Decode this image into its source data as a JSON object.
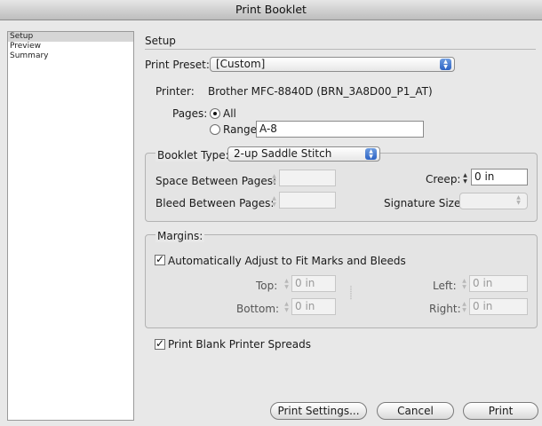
{
  "window": {
    "title": "Print Booklet"
  },
  "sidebar": {
    "items": [
      {
        "label": "Setup",
        "selected": true
      },
      {
        "label": "Preview",
        "selected": false
      },
      {
        "label": "Summary",
        "selected": false
      }
    ]
  },
  "setup": {
    "section_title": "Setup",
    "print_preset_label": "Print Preset:",
    "print_preset_value": "[Custom]",
    "printer_label": "Printer:",
    "printer_value": "Brother MFC-8840D (BRN_3A8D00_P1_AT)",
    "pages_label": "Pages:",
    "all_label": "All",
    "range_label": "Range:",
    "range_value": "A-8",
    "pages_selected": "All"
  },
  "booklet": {
    "type_label": "Booklet Type:",
    "type_value": "2-up Saddle Stitch",
    "space_between_label": "Space Between Pages:",
    "space_between_value": "",
    "bleed_between_label": "Bleed Between Pages:",
    "bleed_between_value": "",
    "creep_label": "Creep:",
    "creep_value": "0 in",
    "signature_label": "Signature Size:",
    "signature_value": ""
  },
  "margins": {
    "section_label": "Margins:",
    "auto_adjust_label": "Automatically Adjust to Fit Marks and Bleeds",
    "auto_adjust_checked": true,
    "top_label": "Top:",
    "top_value": "0 in",
    "bottom_label": "Bottom:",
    "bottom_value": "0 in",
    "left_label": "Left:",
    "left_value": "0 in",
    "right_label": "Right:",
    "right_value": "0 in"
  },
  "options": {
    "print_blank_label": "Print Blank Printer Spreads",
    "print_blank_checked": true
  },
  "buttons": {
    "print_settings": "Print Settings...",
    "cancel": "Cancel",
    "print": "Print"
  },
  "colors": {
    "accent": "#3a6fd0",
    "disabled_text": "#999999"
  },
  "icons": [
    "stepper-icon",
    "popup-arrows-icon",
    "chain-link-icon",
    "radio-icon",
    "checkbox-icon"
  ]
}
